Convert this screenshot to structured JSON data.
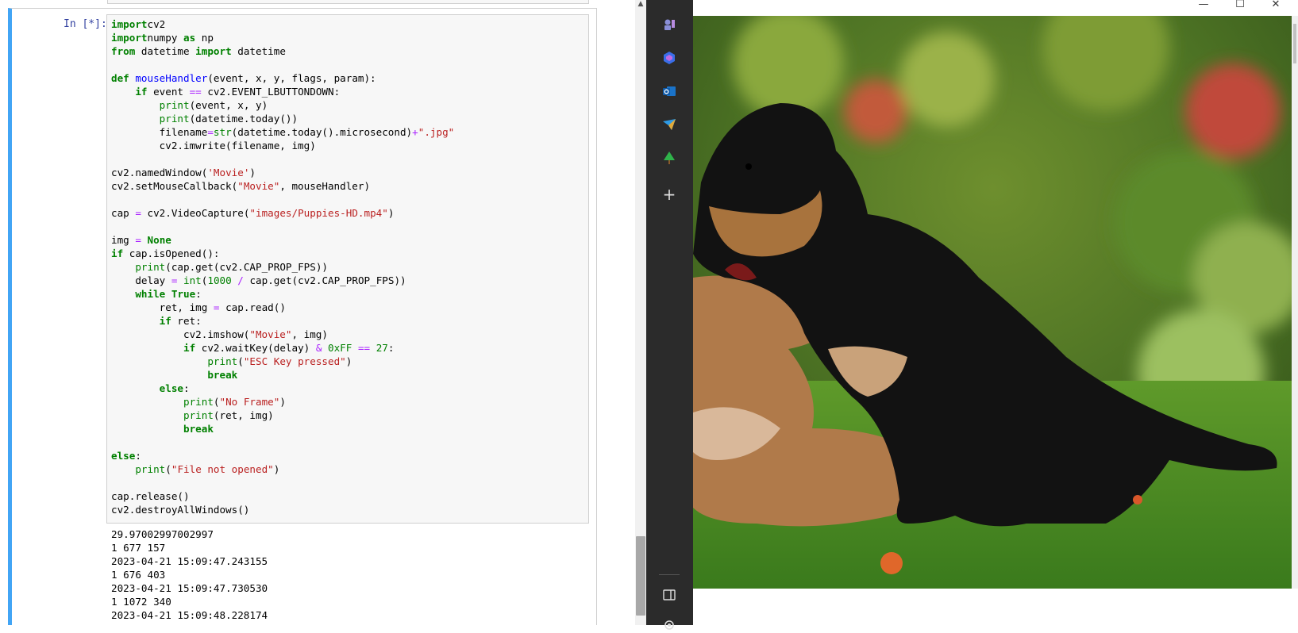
{
  "notebook": {
    "prompt": "In [*]:",
    "code_lines": [
      [
        [
          "kw",
          "import"
        ],
        [
          "",
          "cv2"
        ]
      ],
      [
        [
          "kw",
          "import"
        ],
        [
          "",
          "numpy "
        ],
        [
          "kw",
          "as"
        ],
        [
          "",
          " np"
        ]
      ],
      [
        [
          "kw",
          "from"
        ],
        [
          "",
          " datetime "
        ],
        [
          "kw",
          "import"
        ],
        [
          "",
          " datetime"
        ]
      ],
      [
        [
          "",
          ""
        ]
      ],
      [
        [
          "kw",
          "def "
        ],
        [
          "nf",
          "mouseHandler"
        ],
        [
          "",
          "(event, x, y, flags, param):"
        ]
      ],
      [
        [
          "",
          "    "
        ],
        [
          "kw",
          "if"
        ],
        [
          "",
          " event "
        ],
        [
          "op",
          "=="
        ],
        [
          "",
          " cv2.EVENT_LBUTTONDOWN:"
        ]
      ],
      [
        [
          "",
          "        "
        ],
        [
          "bi",
          "print"
        ],
        [
          "",
          "(event, x, y)"
        ]
      ],
      [
        [
          "",
          "        "
        ],
        [
          "bi",
          "print"
        ],
        [
          "",
          "(datetime.today())"
        ]
      ],
      [
        [
          "",
          "        filename"
        ],
        [
          "op",
          "="
        ],
        [
          "bi",
          "str"
        ],
        [
          "",
          "(datetime.today().microsecond)"
        ],
        [
          "op",
          "+"
        ],
        [
          "st",
          "\".jpg\""
        ]
      ],
      [
        [
          "",
          "        cv2.imwrite(filename, img)"
        ]
      ],
      [
        [
          "",
          ""
        ]
      ],
      [
        [
          "",
          "cv2.namedWindow("
        ],
        [
          "st",
          "'Movie'"
        ],
        [
          "",
          ")"
        ]
      ],
      [
        [
          "",
          "cv2.setMouseCallback("
        ],
        [
          "st",
          "\"Movie\""
        ],
        [
          "",
          ", mouseHandler)"
        ]
      ],
      [
        [
          "",
          ""
        ]
      ],
      [
        [
          "",
          "cap "
        ],
        [
          "op",
          "="
        ],
        [
          "",
          " cv2.VideoCapture("
        ],
        [
          "st",
          "\"images/Puppies-HD.mp4\""
        ],
        [
          "",
          ")"
        ]
      ],
      [
        [
          "",
          ""
        ]
      ],
      [
        [
          "",
          "img "
        ],
        [
          "op",
          "="
        ],
        [
          "",
          " "
        ],
        [
          "kw",
          "None"
        ]
      ],
      [
        [
          "kw",
          "if"
        ],
        [
          "",
          " cap.isOpened():"
        ]
      ],
      [
        [
          "",
          "    "
        ],
        [
          "bi",
          "print"
        ],
        [
          "",
          "(cap.get(cv2.CAP_PROP_FPS))"
        ]
      ],
      [
        [
          "",
          "    delay "
        ],
        [
          "op",
          "="
        ],
        [
          "",
          " "
        ],
        [
          "bi",
          "int"
        ],
        [
          "",
          "("
        ],
        [
          "nm",
          "1000"
        ],
        [
          "",
          " "
        ],
        [
          "op",
          "/"
        ],
        [
          "",
          " cap.get(cv2.CAP_PROP_FPS))"
        ]
      ],
      [
        [
          "",
          "    "
        ],
        [
          "kw",
          "while"
        ],
        [
          "",
          " "
        ],
        [
          "kw",
          "True"
        ],
        [
          "",
          ":"
        ]
      ],
      [
        [
          "",
          "        ret, img "
        ],
        [
          "op",
          "="
        ],
        [
          "",
          " cap.read()"
        ]
      ],
      [
        [
          "",
          "        "
        ],
        [
          "kw",
          "if"
        ],
        [
          "",
          " ret:"
        ]
      ],
      [
        [
          "",
          "            cv2.imshow("
        ],
        [
          "st",
          "\"Movie\""
        ],
        [
          "",
          ", img)"
        ]
      ],
      [
        [
          "",
          "            "
        ],
        [
          "kw",
          "if"
        ],
        [
          "",
          " cv2.waitKey(delay) "
        ],
        [
          "op",
          "&"
        ],
        [
          "",
          " "
        ],
        [
          "nm",
          "0xFF"
        ],
        [
          "",
          " "
        ],
        [
          "op",
          "=="
        ],
        [
          "",
          " "
        ],
        [
          "nm",
          "27"
        ],
        [
          "",
          ":"
        ]
      ],
      [
        [
          "",
          "                "
        ],
        [
          "bi",
          "print"
        ],
        [
          "",
          "("
        ],
        [
          "st",
          "\"ESC Key pressed\""
        ],
        [
          "",
          ")"
        ]
      ],
      [
        [
          "",
          "                "
        ],
        [
          "kw",
          "break"
        ]
      ],
      [
        [
          "",
          "        "
        ],
        [
          "kw",
          "else"
        ],
        [
          "",
          ":"
        ]
      ],
      [
        [
          "",
          "            "
        ],
        [
          "bi",
          "print"
        ],
        [
          "",
          "("
        ],
        [
          "st",
          "\"No Frame\""
        ],
        [
          "",
          ")"
        ]
      ],
      [
        [
          "",
          "            "
        ],
        [
          "bi",
          "print"
        ],
        [
          "",
          "(ret, img)"
        ]
      ],
      [
        [
          "",
          "            "
        ],
        [
          "kw",
          "break"
        ]
      ],
      [
        [
          "",
          ""
        ]
      ],
      [
        [
          "kw",
          "else"
        ],
        [
          "",
          ":"
        ]
      ],
      [
        [
          "",
          "    "
        ],
        [
          "bi",
          "print"
        ],
        [
          "",
          "("
        ],
        [
          "st",
          "\"File not opened\""
        ],
        [
          "",
          ")"
        ]
      ],
      [
        [
          "",
          ""
        ]
      ],
      [
        [
          "",
          "cap.release()"
        ]
      ],
      [
        [
          "",
          "cv2.destroyAllWindows()"
        ]
      ]
    ],
    "output_lines": [
      "29.97002997002997",
      "1 677 157",
      "2023-04-21 15:09:47.243155",
      "1 676 403",
      "2023-04-21 15:09:47.730530",
      "1 1072 340",
      "2023-04-21 15:09:48.228174"
    ]
  },
  "sidebar": {
    "icons": [
      "chess-pawn-icon",
      "copilot-icon",
      "outlook-icon",
      "send-icon",
      "tree-icon",
      "add-icon",
      "split-screen-icon",
      "settings-icon"
    ],
    "add_label": "+"
  },
  "cv_window": {
    "minimize": "—",
    "maximize": "☐",
    "close": "✕",
    "video_subject": "puppies-playing"
  }
}
